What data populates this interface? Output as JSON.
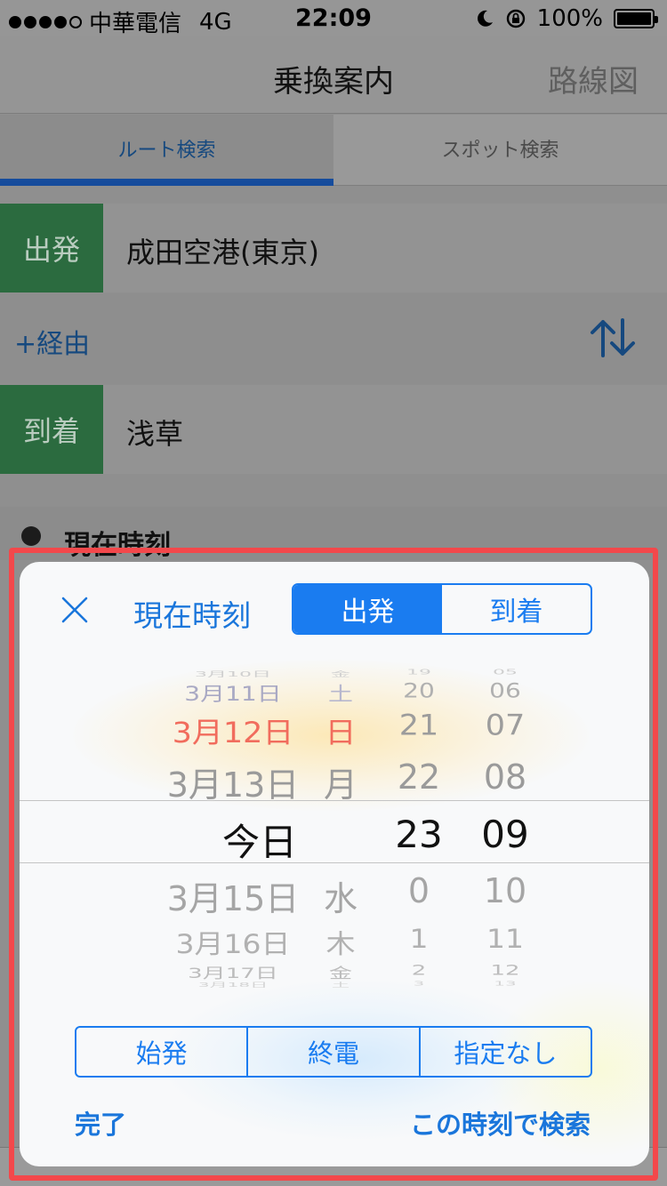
{
  "status": {
    "carrier": "中華電信",
    "network": "4G",
    "time": "22:09",
    "battery": "100%"
  },
  "nav": {
    "title": "乗換案内",
    "right": "路線図"
  },
  "tabs": [
    {
      "label": "ルート検索"
    },
    {
      "label": "スポット検索"
    }
  ],
  "route": {
    "departure_badge": "出発",
    "departure_station": "成田空港(東京)",
    "via_label": "+経由",
    "arrival_badge": "到着",
    "arrival_station": "浅草"
  },
  "time_row": {
    "label": "現在時刻"
  },
  "sheet": {
    "now_button": "現在時刻",
    "segment": [
      {
        "label": "出発",
        "selected": true
      },
      {
        "label": "到着",
        "selected": false
      }
    ],
    "picker": {
      "rows": [
        {
          "date": "3月10日",
          "dow": "金",
          "hour": "19",
          "minute": "05"
        },
        {
          "date": "3月11日",
          "dow": "土",
          "hour": "20",
          "minute": "06"
        },
        {
          "date": "3月12日",
          "dow": "日",
          "hour": "21",
          "minute": "07"
        },
        {
          "date": "3月13日",
          "dow": "月",
          "hour": "22",
          "minute": "08"
        },
        {
          "date": "今日",
          "dow": "",
          "hour": "23",
          "minute": "09"
        },
        {
          "date": "3月15日",
          "dow": "水",
          "hour": "0",
          "minute": "10"
        },
        {
          "date": "3月16日",
          "dow": "木",
          "hour": "1",
          "minute": "11"
        },
        {
          "date": "3月17日",
          "dow": "金",
          "hour": "2",
          "minute": "12"
        },
        {
          "date": "3月18日",
          "dow": "土",
          "hour": "3",
          "minute": "13"
        }
      ],
      "selected_index": 4
    },
    "options": [
      "始発",
      "終電",
      "指定なし"
    ],
    "done": "完了",
    "search": "この時刻で検索"
  },
  "colors": {
    "accent": "#1a7cf0",
    "badge_green": "#2b6b3f",
    "highlight_frame": "#f3484b",
    "sunday_red": "#f16c5d"
  }
}
